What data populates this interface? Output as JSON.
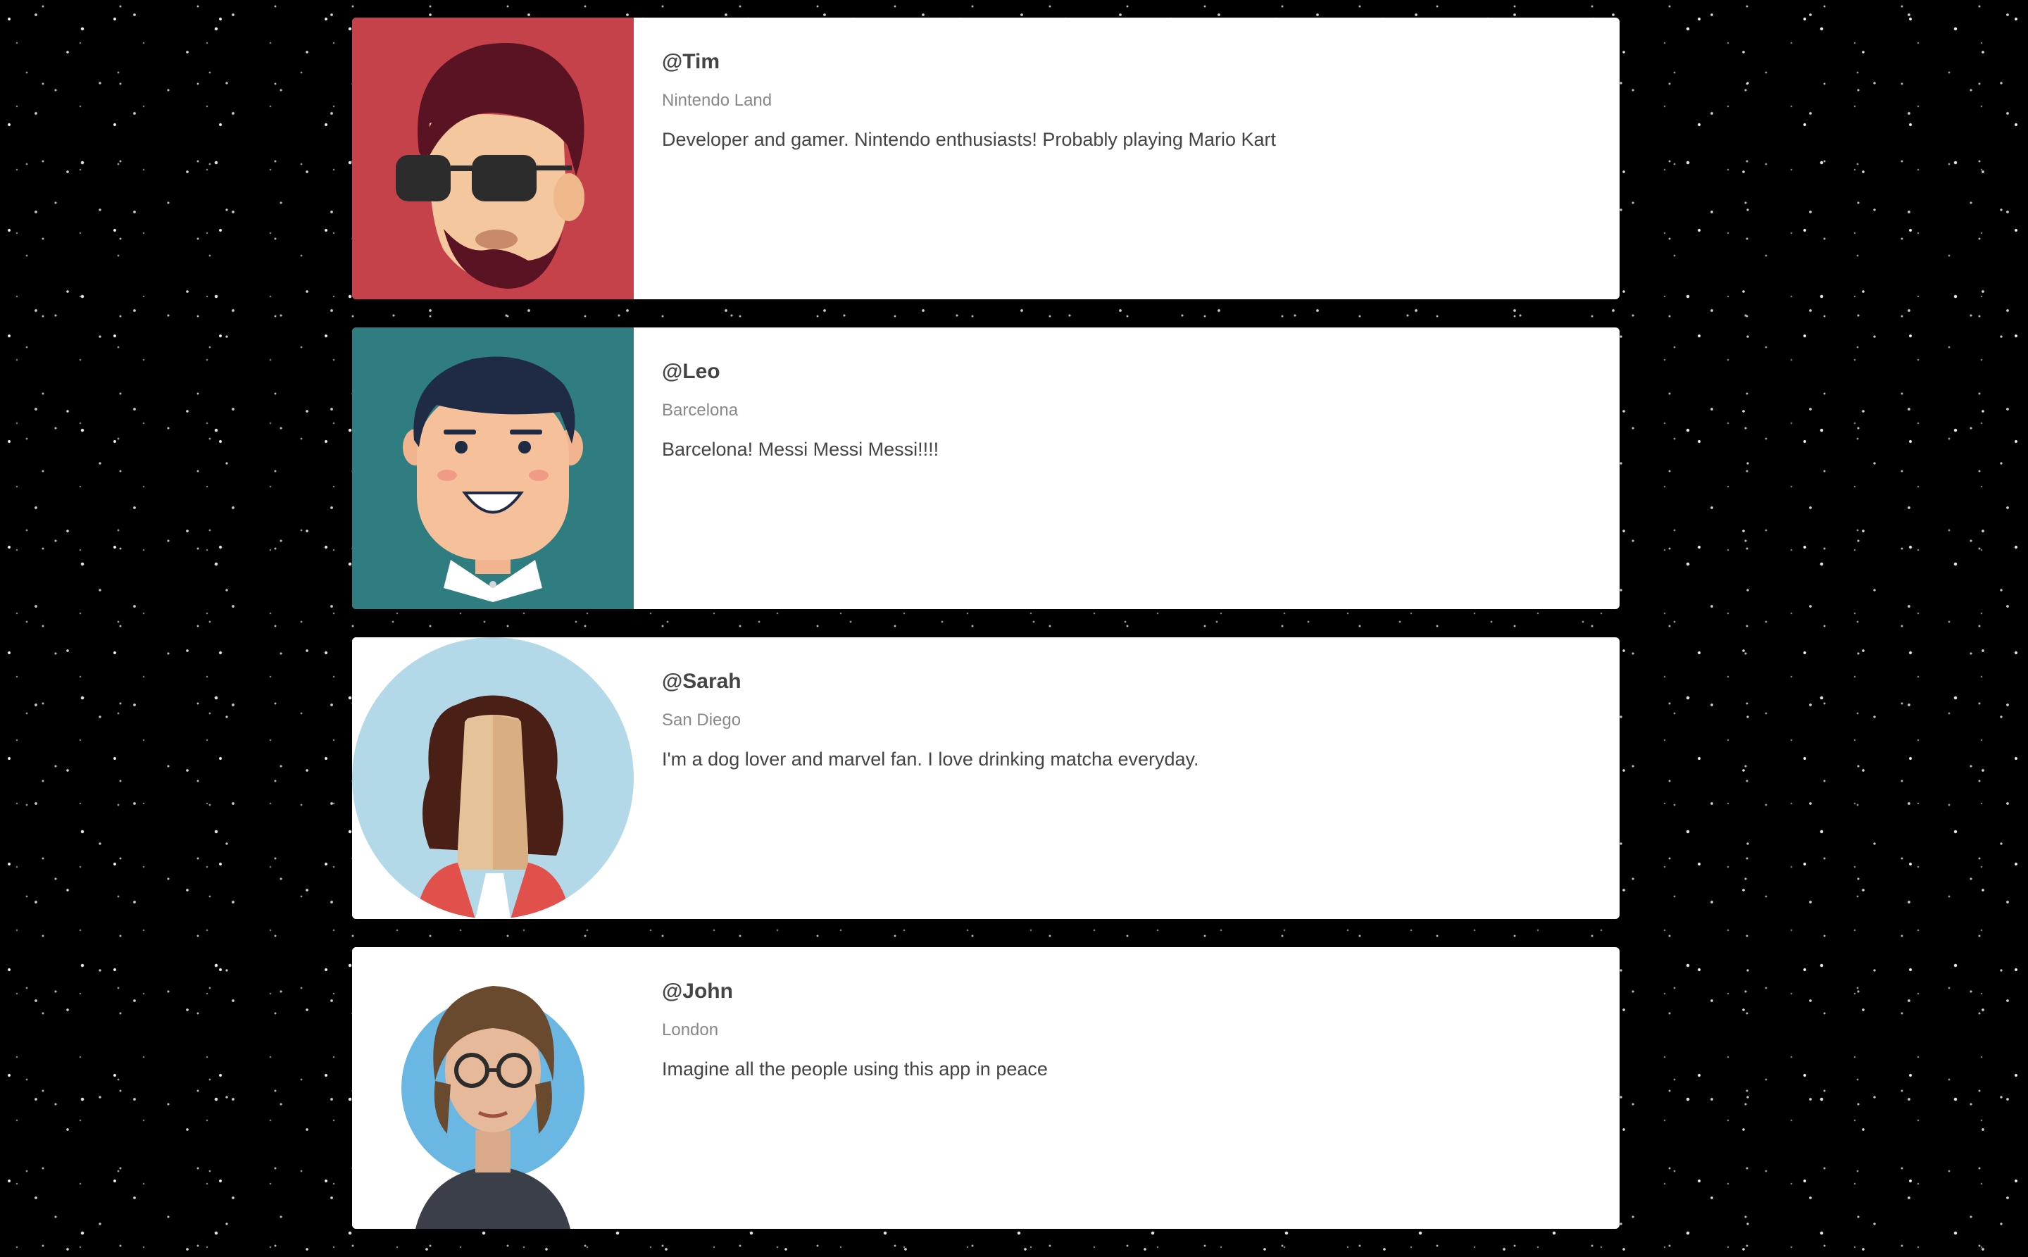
{
  "profiles": [
    {
      "handle": "@Tim",
      "location": "Nintendo Land",
      "bio": "Developer and gamer. Nintendo enthusiasts! Probably playing Mario Kart",
      "avatar_icon": "bearded-man-sunglasses-avatar",
      "avatar_bg": "#c5424a"
    },
    {
      "handle": "@Leo",
      "location": "Barcelona",
      "bio": "Barcelona! Messi Messi Messi!!!!",
      "avatar_icon": "smiling-boy-avatar",
      "avatar_bg": "#2f7d80"
    },
    {
      "handle": "@Sarah",
      "location": "San Diego",
      "bio": "I'm a dog lover and marvel fan. I love drinking matcha everyday.",
      "avatar_icon": "woman-long-hair-avatar",
      "avatar_bg": "#b3d9e9"
    },
    {
      "handle": "@John",
      "location": "London",
      "bio": "Imagine all the people using this app in peace",
      "avatar_icon": "man-round-glasses-avatar",
      "avatar_bg": "#ffffff"
    }
  ]
}
